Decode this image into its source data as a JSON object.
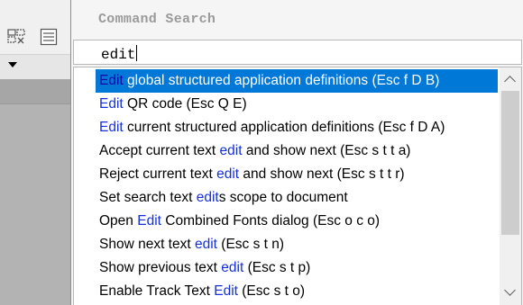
{
  "window": {
    "title": "Command Search"
  },
  "search": {
    "value": "edit"
  },
  "results": [
    {
      "pre": "",
      "hl": "Edit",
      "post": " global structured application definitions  (Esc f D B)",
      "selected": true
    },
    {
      "pre": "",
      "hl": "Edit",
      "post": " QR code  (Esc Q E)",
      "selected": false
    },
    {
      "pre": "",
      "hl": "Edit",
      "post": " current structured application definitions  (Esc f D A)",
      "selected": false
    },
    {
      "pre": "Accept current text ",
      "hl": "edit",
      "post": " and show next  (Esc s t t a)",
      "selected": false
    },
    {
      "pre": "Reject current text ",
      "hl": "edit",
      "post": " and show next  (Esc s t t r)",
      "selected": false
    },
    {
      "pre": "Set search text ",
      "hl": "edit",
      "post": "s scope to document",
      "selected": false
    },
    {
      "pre": "Open ",
      "hl": "Edit",
      "post": " Combined Fonts dialog  (Esc o c o)",
      "selected": false
    },
    {
      "pre": "Show next text ",
      "hl": "edit",
      "post": "  (Esc s t n)",
      "selected": false
    },
    {
      "pre": "Show previous text ",
      "hl": "edit",
      "post": "  (Esc s t p)",
      "selected": false
    },
    {
      "pre": "Enable Track Text ",
      "hl": "Edit",
      "post": "  (Esc s t o)",
      "selected": false
    }
  ],
  "icons": {
    "toolbar_a": "shapes-grid-icon",
    "toolbar_b": "form-panel-icon",
    "dropdown": "chevron-down-icon",
    "scroll_up": "scroll-up-arrow-icon",
    "scroll_down": "scroll-down-arrow-icon"
  },
  "colors": {
    "selection": "#0078d7",
    "match_highlight": "#1530d8",
    "title_text": "#9a9a9a"
  }
}
